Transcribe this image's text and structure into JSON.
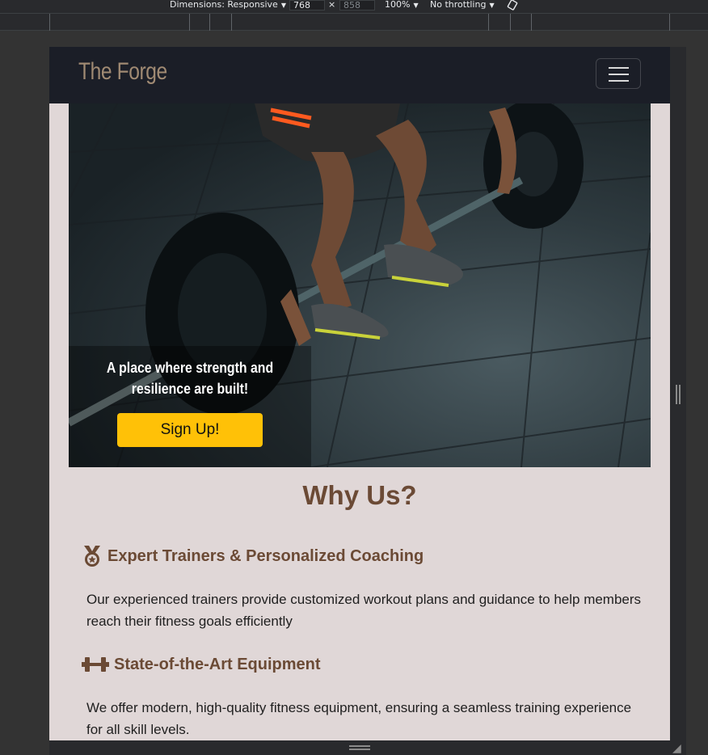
{
  "devtools": {
    "dimensions_label": "Dimensions: Responsive",
    "width_value": "768",
    "times": "×",
    "height_value": "858",
    "zoom": "100%",
    "throttling": "No throttling"
  },
  "navbar": {
    "brand": "The Forge"
  },
  "hero": {
    "tagline": "A place where strength and resilience are built!",
    "cta_label": "Sign Up!"
  },
  "why_us": {
    "title": "Why Us?",
    "features": [
      {
        "icon": "medal-icon",
        "title": "Expert Trainers & Personalized Coaching",
        "text": "Our experienced trainers provide customized workout plans and guidance to help members reach their fitness goals efficiently"
      },
      {
        "icon": "dumbbell-icon",
        "title": "State-of-the-Art Equipment",
        "text": "We offer modern, high-quality fitness equipment, ensuring a seamless training experience for all skill levels."
      }
    ]
  },
  "colors": {
    "page_bg": "#e0d7d7",
    "navbar_bg": "#1b1e27",
    "brand": "#a08a73",
    "accent": "#ffc107",
    "heading": "#6b4a35"
  }
}
